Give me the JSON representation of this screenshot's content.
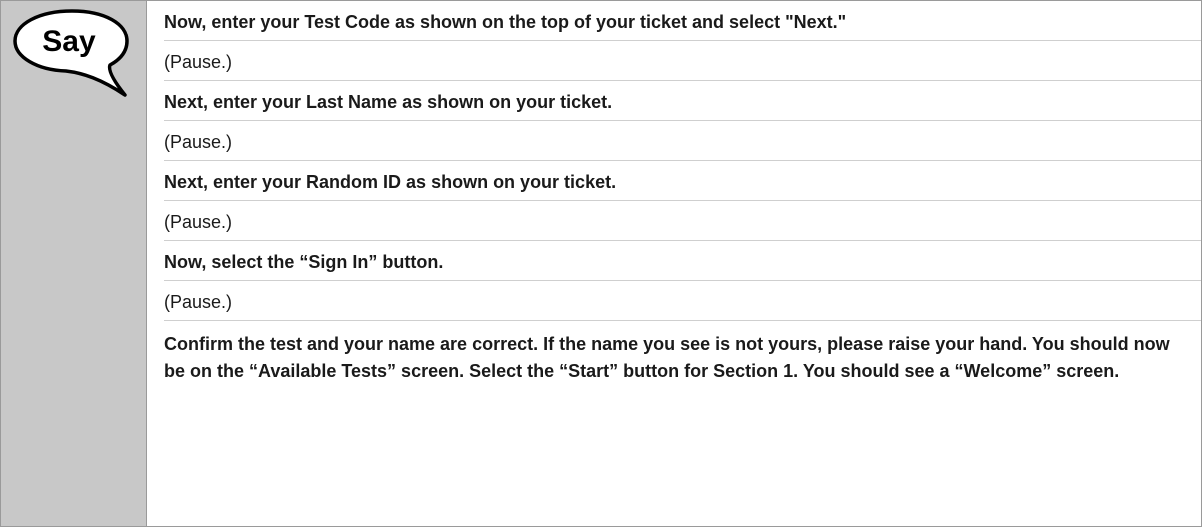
{
  "icon": {
    "label": "Say",
    "name": "say-speech-bubble-icon"
  },
  "lines": [
    {
      "text": "Now, enter your Test Code as shown on the top of your ticket and select \"Next.\"",
      "bold": true
    },
    {
      "text": "(Pause.)",
      "bold": false
    },
    {
      "text": "Next, enter your Last Name as shown on your ticket.",
      "bold": true
    },
    {
      "text": "(Pause.)",
      "bold": false
    },
    {
      "text": "Next, enter your Random ID as shown on your ticket.",
      "bold": true
    },
    {
      "text": "(Pause.)",
      "bold": false
    },
    {
      "text": "Now, select the “Sign In” button.",
      "bold": true
    },
    {
      "text": "(Pause.)",
      "bold": false
    },
    {
      "text": "Confirm the test and your name are correct. If the name you see is not yours, please raise your hand. You should now be on the “Available Tests” screen. Select the “Start” button for Section 1. You should see a “Welcome” screen.",
      "bold": true
    }
  ]
}
